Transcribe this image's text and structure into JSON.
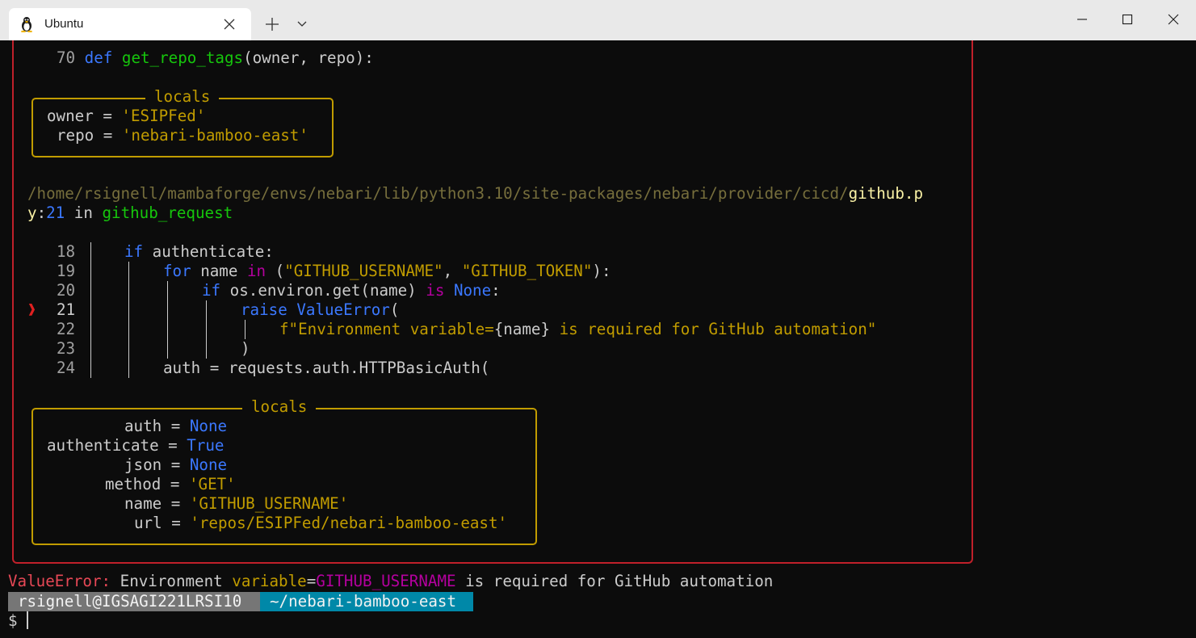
{
  "window": {
    "tab_title": "Ubuntu",
    "tab_icon": "linux-tux-icon",
    "controls": [
      "new-tab-icon",
      "chevron-down-icon",
      "minimize-icon",
      "maximize-icon",
      "close-icon"
    ]
  },
  "traceback": {
    "frame1": {
      "line_no": "70",
      "code": {
        "kw": "def",
        "fn": "get_repo_tags",
        "args": "(owner, repo):"
      },
      "locals_title": "locals",
      "locals": [
        {
          "name": "owner",
          "value": "'ESIPFed'"
        },
        {
          "name": "repo",
          "value": "'nebari-bamboo-east'"
        }
      ]
    },
    "frame2": {
      "path_dir": "/home/rsignell/mambaforge/envs/nebari/lib/python3.10/site-packages/nebari/provider/cicd/",
      "file_part1": "github.p",
      "file_part2": "y",
      "line_ref": "21",
      "in_word": "in",
      "func": "github_request",
      "current_line_marker": "❱",
      "code_lines": [
        {
          "no": "18",
          "parts": [
            {
              "c": "kw",
              "t": "if"
            },
            {
              "c": "txt",
              "t": " authenticate:"
            }
          ]
        },
        {
          "no": "19",
          "parts": [
            {
              "c": "kw",
              "t": "for"
            },
            {
              "c": "txt",
              "t": " name "
            },
            {
              "c": "pu",
              "t": "in"
            },
            {
              "c": "txt",
              "t": " ("
            },
            {
              "c": "str",
              "t": "\"GITHUB_USERNAME\""
            },
            {
              "c": "txt",
              "t": ", "
            },
            {
              "c": "str",
              "t": "\"GITHUB_TOKEN\""
            },
            {
              "c": "txt",
              "t": "):"
            }
          ]
        },
        {
          "no": "20",
          "parts": [
            {
              "c": "kw",
              "t": "if"
            },
            {
              "c": "txt",
              "t": " os.environ.get(name) "
            },
            {
              "c": "pu",
              "t": "is"
            },
            {
              "c": "txt",
              "t": " "
            },
            {
              "c": "kw",
              "t": "None"
            },
            {
              "c": "txt",
              "t": ":"
            }
          ]
        },
        {
          "no": "21",
          "parts": [
            {
              "c": "kw",
              "t": "raise"
            },
            {
              "c": "txt",
              "t": " "
            },
            {
              "c": "cls",
              "t": "ValueError"
            },
            {
              "c": "txt",
              "t": "("
            }
          ]
        },
        {
          "no": "22",
          "parts": [
            {
              "c": "str",
              "t": "f\"Environment variable="
            },
            {
              "c": "txt",
              "t": "{name}"
            },
            {
              "c": "str",
              "t": " is required for GitHub automation\""
            }
          ]
        },
        {
          "no": "23",
          "parts": [
            {
              "c": "txt",
              "t": ")"
            }
          ]
        },
        {
          "no": "24",
          "parts": [
            {
              "c": "txt",
              "t": "auth = requests.auth.HTTPBasicAuth("
            }
          ]
        }
      ],
      "locals_title": "locals",
      "locals": [
        {
          "name": "auth",
          "value": "None",
          "type": "kw"
        },
        {
          "name": "authenticate",
          "value": "True",
          "type": "kw"
        },
        {
          "name": "json",
          "value": "None",
          "type": "kw"
        },
        {
          "name": "method",
          "value": "'GET'",
          "type": "str"
        },
        {
          "name": "name",
          "value": "'GITHUB_USERNAME'",
          "type": "str"
        },
        {
          "name": "url",
          "value": "'repos/ESIPFed/nebari-bamboo-east'",
          "type": "str"
        }
      ]
    }
  },
  "error": {
    "type": "ValueError:",
    "msg1": "Environment",
    "msg2": "variable",
    "msg3": "=",
    "msg4": "GITHUB_USERNAME",
    "msg5": "is required for GitHub automation"
  },
  "prompt": {
    "user_host": "rsignell@IGSAGI221LRSI10",
    "cwd": "~/nebari-bamboo-east",
    "symbol": "$"
  },
  "colors": {
    "frame_border": "#c0202a",
    "locals_border": "#c19c00",
    "keyword": "#3b78ff",
    "function": "#16c60c",
    "string": "#c19c00",
    "prompt_user_bg": "#767676",
    "prompt_dir_bg": "#0088a8"
  }
}
